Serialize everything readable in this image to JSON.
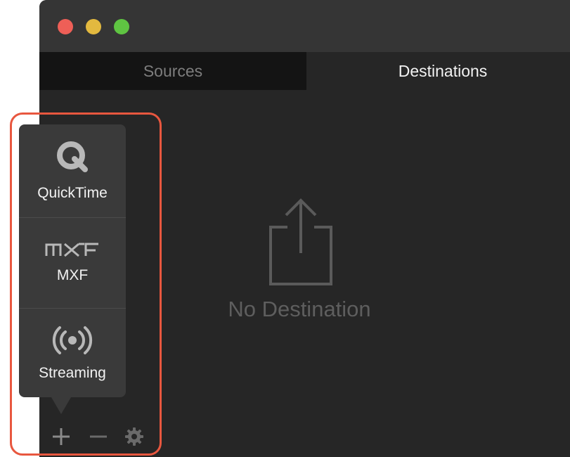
{
  "window": {
    "traffic_lights": [
      "close",
      "minimize",
      "maximize"
    ]
  },
  "tabs": [
    {
      "label": "Sources",
      "active": false
    },
    {
      "label": "Destinations",
      "active": true
    }
  ],
  "empty_state": {
    "icon": "share-icon",
    "text": "No Destination"
  },
  "popover": {
    "items": [
      {
        "label": "QuickTime",
        "icon": "quicktime-icon"
      },
      {
        "label": "MXF",
        "icon": "mxf-icon"
      },
      {
        "label": "Streaming",
        "icon": "streaming-icon"
      }
    ]
  },
  "toolbar": {
    "buttons": [
      {
        "name": "add",
        "glyph": "+"
      },
      {
        "name": "remove",
        "glyph": "−"
      },
      {
        "name": "settings",
        "icon": "gear-icon"
      }
    ]
  },
  "colors": {
    "highlight": "#e8573f",
    "close": "#ee5f57",
    "minimize": "#e3b93f",
    "maximize": "#5fc442"
  }
}
